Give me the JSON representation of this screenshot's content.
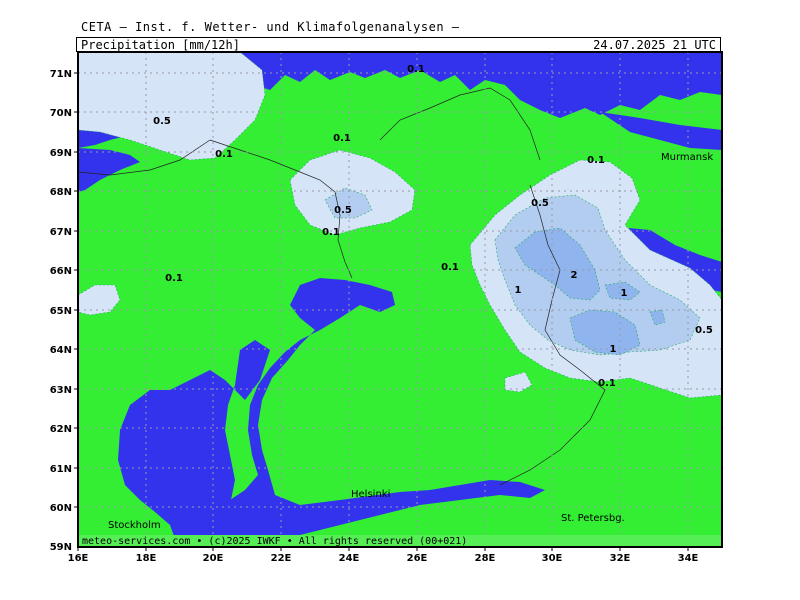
{
  "header": {
    "agency": "CETA — Inst. f. Wetter- und Klimafolgenanalysen —",
    "parameter": "Precipitation [mm/12h]",
    "valid_time": "24.07.2025 21 UTC"
  },
  "axes": {
    "lat_labels": [
      "71N",
      "70N",
      "69N",
      "68N",
      "67N",
      "66N",
      "65N",
      "64N",
      "63N",
      "62N",
      "61N",
      "60N",
      "59N"
    ],
    "lon_labels": [
      "16E",
      "18E",
      "20E",
      "22E",
      "24E",
      "26E",
      "28E",
      "30E",
      "32E",
      "34E"
    ]
  },
  "contour_labels": [
    "0.1",
    "0.5",
    "0.1",
    "0.1",
    "0.5",
    "0.1",
    "0.1",
    "0.1",
    "0.5",
    "1",
    "2",
    "0.1",
    "1",
    "1",
    "0.5",
    "0.1"
  ],
  "cities": [
    "Murmansk",
    "Helsinki",
    "Stockholm",
    "St. Petersbg."
  ],
  "footer": "meteo-services.com • (c)2025 IWKF • All rights reserved (00+021)",
  "colors": {
    "land": "#33ee33",
    "sea": "#3333ee",
    "precip_01": "#d6e4f7",
    "precip_05": "#b3cdf0",
    "precip_1": "#8fb4ee",
    "grid": "#9999aa"
  }
}
